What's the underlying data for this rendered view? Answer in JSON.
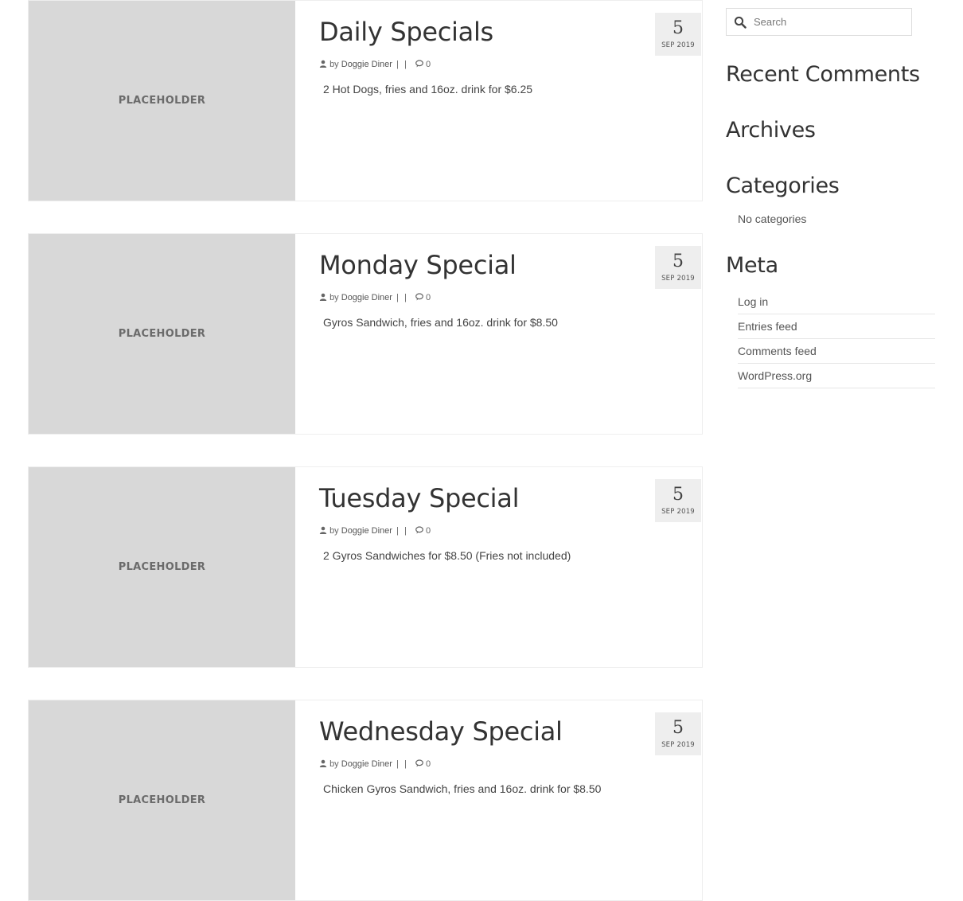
{
  "posts": [
    {
      "title": "Daily Specials",
      "thumbnail_text": "PLACEHOLDER",
      "by": "by",
      "author": "Doggie Diner",
      "sep": "|",
      "comments": "0",
      "excerpt": "2 Hot Dogs, fries and 16oz. drink for $6.25",
      "day": "5",
      "month_year": "SEP 2019"
    },
    {
      "title": "Monday Special",
      "thumbnail_text": "PLACEHOLDER",
      "by": "by",
      "author": "Doggie Diner",
      "sep": "|",
      "comments": "0",
      "excerpt": "Gyros Sandwich, fries and 16oz. drink for $8.50",
      "day": "5",
      "month_year": "SEP 2019"
    },
    {
      "title": "Tuesday Special",
      "thumbnail_text": "PLACEHOLDER",
      "by": "by",
      "author": "Doggie Diner",
      "sep": "|",
      "comments": "0",
      "excerpt": "2 Gyros Sandwiches for $8.50 (Fries not included)",
      "day": "5",
      "month_year": "SEP 2019"
    },
    {
      "title": "Wednesday Special",
      "thumbnail_text": "PLACEHOLDER",
      "by": "by",
      "author": "Doggie Diner",
      "sep": "|",
      "comments": "0",
      "excerpt": "Chicken Gyros Sandwich, fries and 16oz. drink for $8.50",
      "day": "5",
      "month_year": "SEP 2019"
    }
  ],
  "sidebar": {
    "search": {
      "placeholder": "Search",
      "value": "",
      "icon": "search-icon"
    },
    "recent_comments_title": "Recent Comments",
    "archives_title": "Archives",
    "categories_title": "Categories",
    "no_categories": "No categories",
    "meta_title": "Meta",
    "meta_links": [
      "Log in",
      "Entries feed",
      "Comments feed",
      "WordPress.org"
    ]
  },
  "icons": {
    "author": "user-icon",
    "comments": "comment-icon"
  },
  "colors": {
    "thumbnail_bg": "#d8d8d8",
    "date_bg": "#eeeeee",
    "title": "#333333"
  }
}
